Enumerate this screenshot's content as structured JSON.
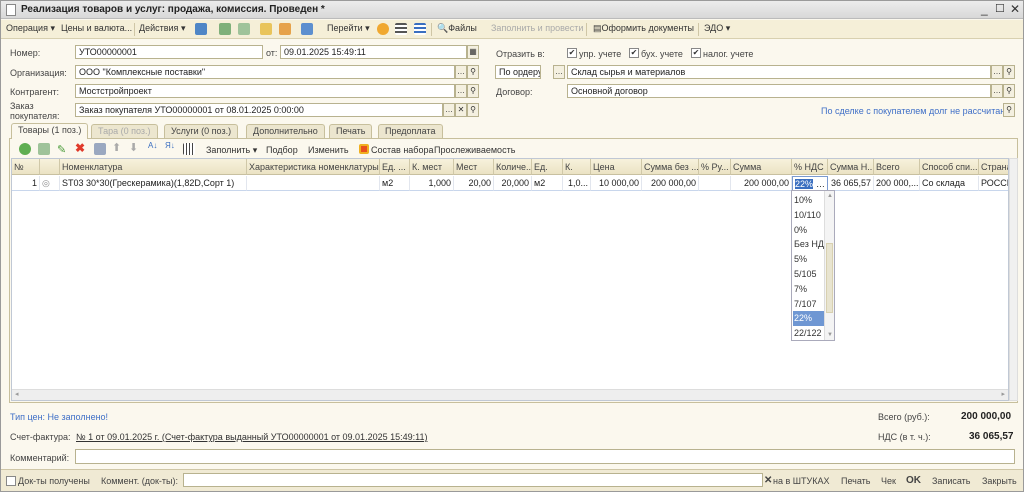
{
  "title": "Реализация товаров и услуг: продажа, комиссия. Проведен *",
  "toolbar": {
    "operation": "Операция",
    "prices": "Цены и валюта...",
    "actions": "Действия",
    "goto": "Перейти",
    "files": "Файлы",
    "fill_post": "Заполнить и провести",
    "make_docs": "Оформить документы",
    "edo": "ЭДО"
  },
  "form": {
    "number_label": "Номер:",
    "number": "УТО00000001",
    "date_label": "от:",
    "date": "09.01.2025 15:49:11",
    "org_label": "Организация:",
    "org": "ООО \"Комплексные поставки\"",
    "contractor_label": "Контрагент:",
    "contractor": "Мостстройпроект",
    "order_label": "Заказ покупателя:",
    "order": "Заказ покупателя УТО00000001 от 08.01.2025 0:00:00",
    "reflect_label": "Отразить в:",
    "reflect": [
      {
        "label": "упр. учете",
        "checked": true
      },
      {
        "label": "бух. учете",
        "checked": true
      },
      {
        "label": "налог. учете",
        "checked": true
      }
    ],
    "by_order": "По ордеру",
    "warehouse": "Склад сырья и материалов",
    "contract_label": "Договор:",
    "contract": "Основной договор",
    "debt_link": "По сделке с покупателем долг не рассчитан"
  },
  "tabs": [
    "Товары (1 поз.)",
    "Тара (0 поз.)",
    "Услуги (0 поз.)",
    "Дополнительно",
    "Печать",
    "Предоплата"
  ],
  "table_toolbar": {
    "fill": "Заполнить",
    "select": "Подбор",
    "change": "Изменить",
    "set": "Состав набора",
    "trace": "Прослеживаемость"
  },
  "grid": {
    "columns": [
      "№",
      "",
      "Номенклатура",
      "Характеристика номенклатуры",
      "Ед. ...",
      "К. мест",
      "Мест",
      "Количе...",
      "Ед.",
      "К.",
      "Цена",
      "Сумма без ...",
      "% Ру...",
      "Сумма",
      "% НДС",
      "Сумма Н...",
      "Всего",
      "Способ спи...",
      "Страна"
    ],
    "rows": [
      [
        "1",
        "",
        "ST03 30*30(Грескерамика)(1,82D,Сорт 1)",
        "",
        "м2",
        "1,000",
        "20,00",
        "20,000",
        "м2",
        "1,0...",
        "10 000,00",
        "200 000,00",
        "",
        "200 000,00",
        "22%",
        "36 065,57",
        "200 000,...",
        "Со склада",
        "РОССИ"
      ]
    ]
  },
  "vat_dropdown": {
    "options": [
      "10%",
      "10/110",
      "0%",
      "Без НДС",
      "5%",
      "5/105",
      "7%",
      "7/107",
      "22%",
      "22/122"
    ],
    "selected": "22%"
  },
  "footer": {
    "price_type": "Тип цен: Не заполнено!",
    "total_label": "Всего (руб.):",
    "total": "200 000,00",
    "invoice_label": "Счет-фактура:",
    "invoice": "№ 1 от 09.01.2025 г. (Счет-фактура выданный УТО00000001 от 09.01.2025 15:49:11)",
    "vat_label": "НДС (в т. ч.):",
    "vat": "36 065,57",
    "comment_label": "Комментарий:",
    "comment": ""
  },
  "bottom": {
    "docs_received": "Док-ты получены",
    "doc_comment_label": "Коммент. (док-ты):",
    "doc_comment": "",
    "pieces": "на в ШТУКАХ",
    "print": "Печать",
    "check": "Чек",
    "ok": "OK",
    "save": "Записать",
    "close": "Закрыть"
  }
}
